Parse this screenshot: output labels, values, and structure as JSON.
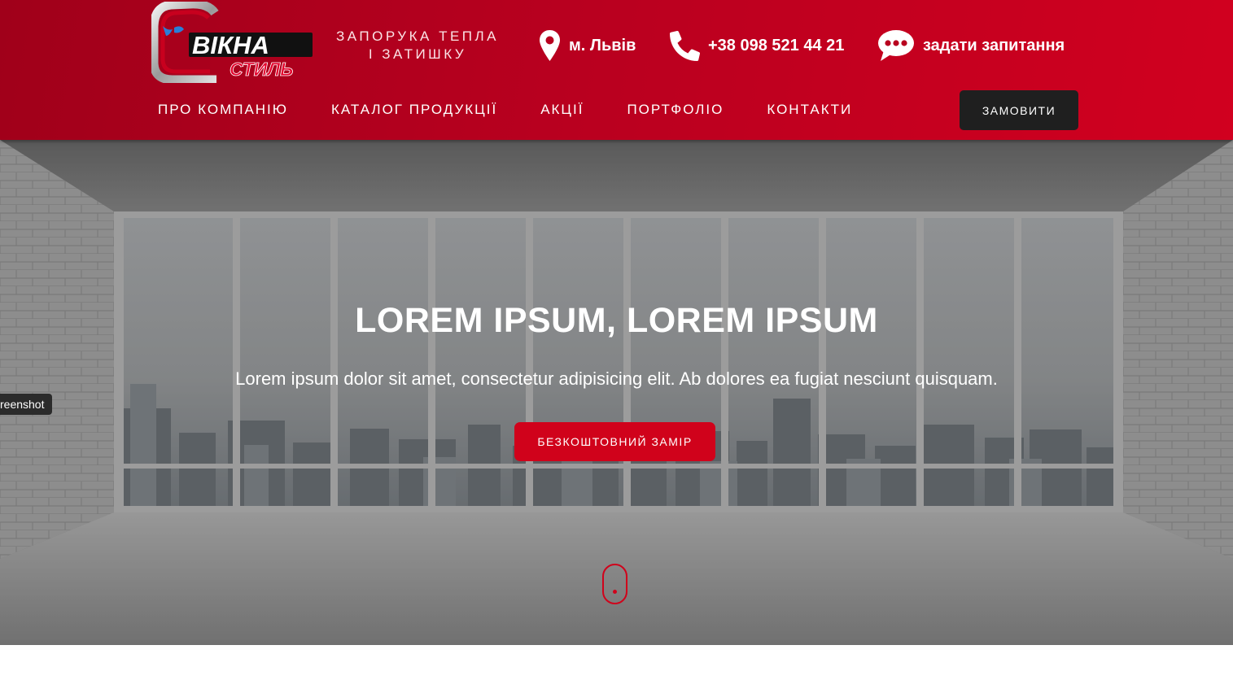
{
  "brand": {
    "logo_text_top": "ВІКНА",
    "logo_text_bottom": "СТИЛЬ",
    "slogan_line1": "ЗАПОРУКА ТЕПЛА",
    "slogan_line2": "І ЗАТИШКУ",
    "accent_color": "#d0021b"
  },
  "contacts": {
    "city": "м. Львів",
    "phone": "+38 098 521 44 21",
    "ask": "задати запитання"
  },
  "nav": {
    "items": [
      {
        "label": "ПРО КОМПАНІЮ"
      },
      {
        "label": "КАТАЛОГ ПРОДУКЦІЇ"
      },
      {
        "label": "АКЦІЇ"
      },
      {
        "label": "ПОРТФОЛІО"
      },
      {
        "label": "КОНТАКТИ"
      }
    ],
    "order_label": "ЗАМОВИТИ"
  },
  "hero": {
    "title": "LOREM IPSUM, LOREM IPSUM",
    "subtitle": "Lorem ipsum dolor sit amet, consectetur adipisicing elit. Ab dolores ea fugiat nesciunt quisquam.",
    "cta_label": "БЕЗКОШТОВНИЙ ЗАМІР",
    "tooltip": "reenshot"
  }
}
